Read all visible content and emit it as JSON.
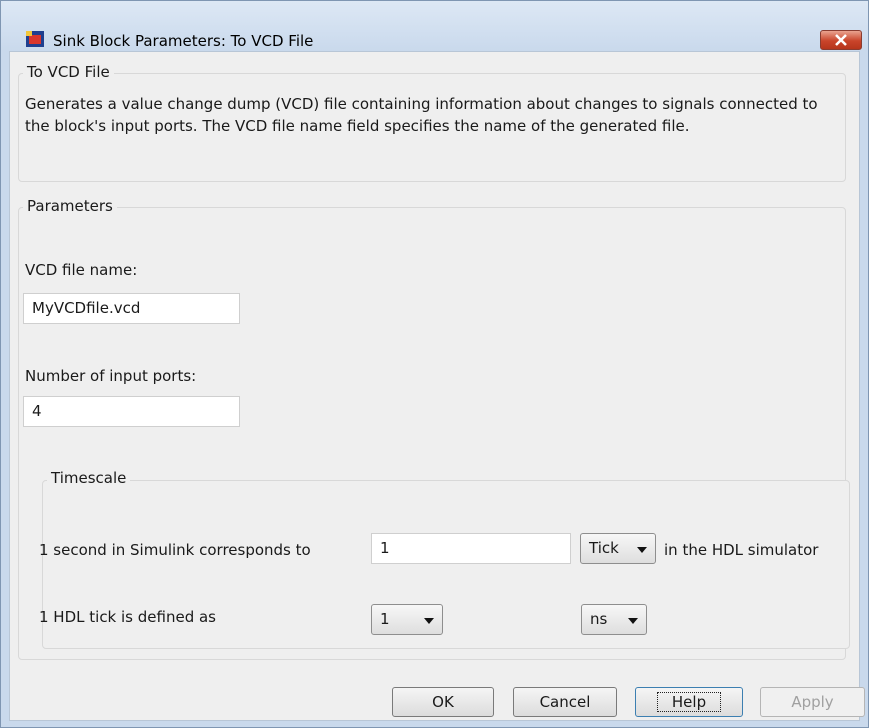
{
  "window": {
    "title": "Sink Block Parameters: To VCD File"
  },
  "description_group": {
    "title": "To VCD File",
    "text": "Generates a value change dump (VCD) file containing information about changes to signals connected to the block's input ports. The VCD file name field specifies the name of the generated file."
  },
  "parameters_group": {
    "title": "Parameters",
    "vcd_file_name_label": "VCD file name:",
    "vcd_file_name_value": "MyVCDfile.vcd",
    "num_ports_label": "Number of input ports:",
    "num_ports_value": "4"
  },
  "timescale_group": {
    "title": "Timescale",
    "sec_label": "1 second in Simulink corresponds to",
    "sec_value": "1",
    "sec_unit": "Tick",
    "sec_suffix": "in the HDL simulator",
    "tick_label": "1 HDL tick is defined as",
    "tick_value": "1",
    "tick_unit": "ns"
  },
  "buttons": {
    "ok": "OK",
    "cancel": "Cancel",
    "help": "Help",
    "apply": "Apply"
  },
  "icons": {
    "app": "simulink-block-icon",
    "close": "close-icon"
  }
}
